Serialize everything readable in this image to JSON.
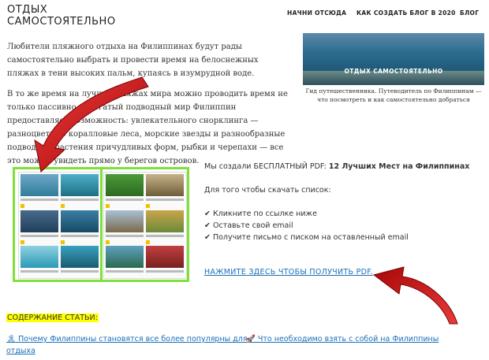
{
  "header": {
    "site_title_line1": "ОТДЫХ",
    "site_title_line2": "САМОСТОЯТЕЛЬНО",
    "nav": [
      "НАЧНИ ОТСЮДА",
      "КАК СОЗДАТЬ БЛОГ В 2020",
      "БЛОГ"
    ]
  },
  "article": {
    "p1": "Любители пляжного отдыха на Филиппинах будут рады самостоятельно выбрать и провести время на белоснежных пляжах в тени высоких пальм, купаясь в изумрудной воде.",
    "p2": "В то же время на лучших пляжах мира можно проводить время не только пассивно — богатый подводный мир Филиппин предоставляет возможность: увлекательного снорклинга — разноцветные коралловые леса, морские звезды и разнообразные подводные растения причудливых форм, рыбки и черепахи — все это можно увидеть прямо у берегов островов."
  },
  "sidebar": {
    "image_caption": "ОТДЫХ САМОСТОЯТЕЛЬНО",
    "caption": "Гид путешественника. Путеводитель по Филиппинам — что посмотреть и как самостоятельно добраться"
  },
  "promo": {
    "line1_prefix": "Мы создали БЕСПЛАТНЫЙ PDF: ",
    "line1_bold": "12 Лучших Мест на Филиппинах",
    "line2": "Для того чтобы скачать список:",
    "checks": [
      "✔ Кликните по ссылке ниже",
      "✔ Оставьте свой email",
      "✔ Получите письмо с писком на оставленный email"
    ],
    "cta": "НАЖМИТЕ ЗДЕСЬ ЧТОБЫ ПОЛУЧИТЬ PDF."
  },
  "toc": {
    "title": "СОДЕРЖАНИЕ СТАТЬИ:",
    "link1": "🏝 Почему Филиппины становятся все более популярны для",
    "link1_cont": "отдыха",
    "link2": "🚀 Что необходимо взять с собой на Филиппины"
  },
  "colors": {
    "accent_link": "#1a6fb8",
    "highlight": "#ffff00",
    "pdf_border": "#7fe03a",
    "arrow": "#d01010"
  }
}
